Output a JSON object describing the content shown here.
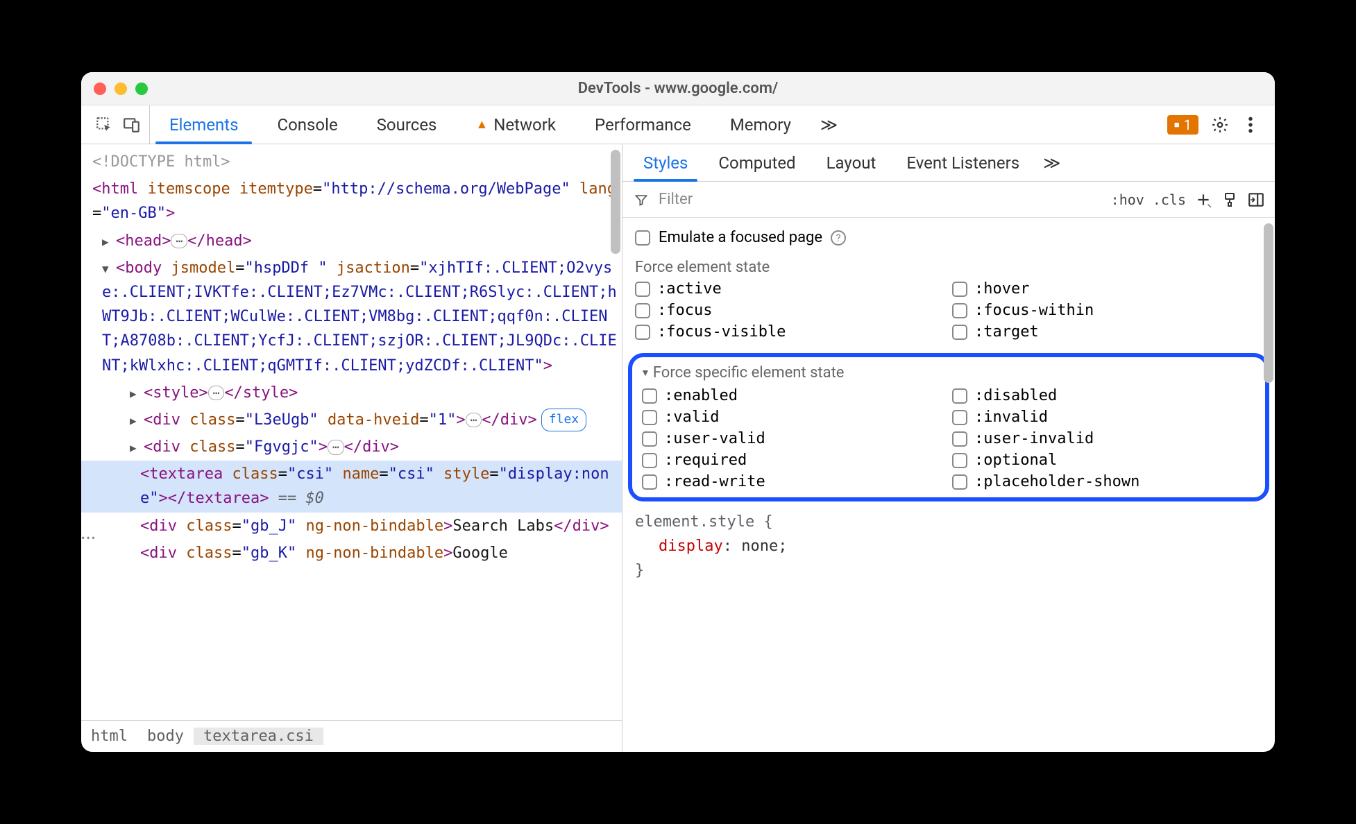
{
  "window": {
    "title": "DevTools - www.google.com/"
  },
  "toolbar": {
    "tabs": [
      "Elements",
      "Console",
      "Sources",
      "Network",
      "Performance",
      "Memory"
    ],
    "more": "≫",
    "warn_count": "1"
  },
  "dom": {
    "doctype": "<!DOCTYPE html>",
    "html_open": {
      "tag": "html",
      "attrs": "itemscope itemtype=\"http://schema.org/WebPage\" lang=\"en-GB\""
    },
    "head": {
      "open": "<head>",
      "close": "</head>"
    },
    "body_open": {
      "tag": "body",
      "attrs": "jsmodel=\"hspDDf \" jsaction=\"xjhTIf:.CLIENT;O2vyse:.CLIENT;IVKTfe:.CLIENT;Ez7VMc:.CLIENT;R6Slyc:.CLIENT;hWT9Jb:.CLIENT;WCulWe:.CLIENT;VM8bg:.CLIENT;qqf0n:.CLIENT;A8708b:.CLIENT;YcfJ:.CLIENT;szjOR:.CLIENT;JL9QDc:.CLIENT;kWlxhc:.CLIENT;qGMTIf:.CLIENT;ydZCDf:.CLIENT\""
    },
    "style_line": {
      "open": "<style>",
      "close": "</style>"
    },
    "div1": {
      "open": "<div class=\"L3eUgb\" data-hveid=\"1\">",
      "close": "</div>",
      "flex": "flex"
    },
    "div2": {
      "open": "<div class=\"Fgvgjc\">",
      "close": "</div>"
    },
    "textarea_line": {
      "html": "<textarea class=\"csi\" name=\"csi\" style=\"display:none\"></textarea>",
      "suffix": " == $0"
    },
    "div_gbj": {
      "prefix": "<div class=\"gb_J\" ng-non-bindable>",
      "text": "Search Labs",
      "suffix": "</div>"
    },
    "div_gbk": {
      "prefix": "<div class=\"gb_K\" ng-non-bindable>",
      "text": "Google"
    }
  },
  "breadcrumb": [
    "html",
    "body",
    "textarea.csi"
  ],
  "styles": {
    "tabs": [
      "Styles",
      "Computed",
      "Layout",
      "Event Listeners"
    ],
    "more": "≫",
    "filter_placeholder": "Filter",
    "hov": ":hov",
    "cls": ".cls",
    "emulate": "Emulate a focused page",
    "force_label": "Force element state",
    "force_states_left": [
      ":active",
      ":focus",
      ":focus-visible"
    ],
    "force_states_right": [
      ":hover",
      ":focus-within",
      ":target"
    ],
    "spec_label": "Force specific element state",
    "spec_left": [
      ":enabled",
      ":valid",
      ":user-valid",
      ":required",
      ":read-write"
    ],
    "spec_right": [
      ":disabled",
      ":invalid",
      ":user-invalid",
      ":optional",
      ":placeholder-shown"
    ],
    "rule_selector": "element.style {",
    "rule_prop": "display",
    "rule_val": "none",
    "rule_close": "}"
  }
}
